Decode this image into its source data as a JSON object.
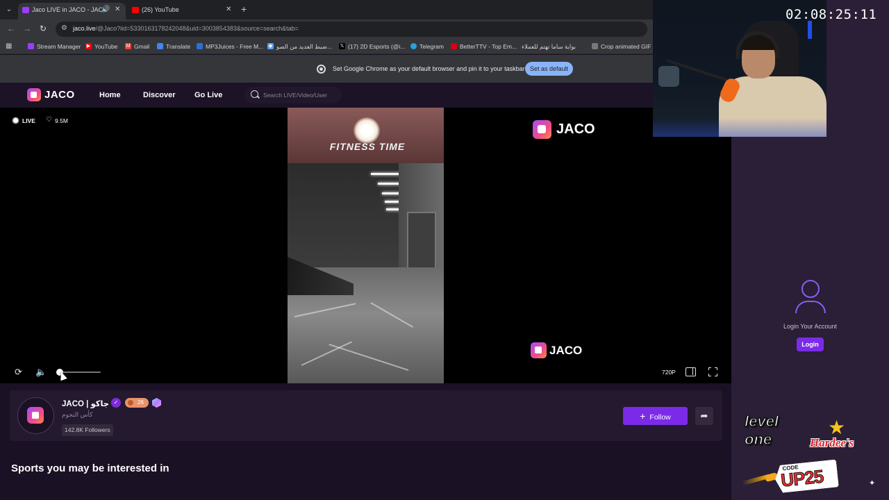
{
  "browser": {
    "tabs": [
      {
        "label": "Jaco LIVE in JACO - JACO",
        "active": true,
        "favicon_color": "#9b3dff"
      },
      {
        "label": "(26) YouTube",
        "active": false,
        "favicon_color": "#ff0000"
      }
    ],
    "tab_close_glyph": "✕",
    "new_tab_glyph": "+",
    "url_host": "jaco.live",
    "url_path": "/@Jaco?iid=5330163178242048&uid=3003854383&source=search&tab=",
    "bookmarks": [
      {
        "label": "Stream Manager",
        "icon_color": "#9b3dff"
      },
      {
        "label": "YouTube",
        "icon_color": "#ff0000"
      },
      {
        "label": "Gmail",
        "icon_color": "#ea4335"
      },
      {
        "label": "Translate",
        "icon_color": "#4285f4"
      },
      {
        "label": "MP3Juices - Free M...",
        "icon_color": "#2b6fd6"
      },
      {
        "label": "ضبط العديد من الصو...",
        "icon_color": "#5aa0ff"
      },
      {
        "label": "(17) 2D Esports (@i...",
        "icon_color": "#000000"
      },
      {
        "label": "Telegram",
        "icon_color": "#2aa1da"
      },
      {
        "label": "BetterTTV - Top Em...",
        "icon_color": "#d50014"
      },
      {
        "label": "بوابة ساما تهتم للعملاء",
        "icon_color": "#3a3a3a"
      },
      {
        "label": "Crop animated GIF",
        "icon_color": "#777777"
      }
    ],
    "infobar": {
      "message": "Set Google Chrome as your default browser and pin it to your taskbar",
      "button": "Set as default"
    }
  },
  "site": {
    "logo_text": "JACO",
    "nav": [
      "Home",
      "Discover",
      "Go Live"
    ],
    "search_placeholder": "Search LIVE/Video/User"
  },
  "player": {
    "live_label": "LIVE",
    "likes": "9.5M",
    "video_sign": "FITNESS TIME",
    "watermark": "JACO",
    "volume_fraction": 0.05,
    "quality": "720P"
  },
  "streamer": {
    "name": "JACO | جاكو",
    "level": "26",
    "subtitle": "كأس النجوم",
    "followers": "142.8K Followers",
    "follow_label": "Follow"
  },
  "section_title": "Sports you may be interested in",
  "sidebar": {
    "login_prompt": "Login Your Account",
    "login_button": "Login"
  },
  "overlay": {
    "timer": "02:08:25:11",
    "sponsor_level_one": "level one",
    "sponsor_hardees": "Hardee's",
    "code_label": "CODE",
    "code_value": "UP25"
  },
  "colors": {
    "accent": "#7b2be8",
    "page_bg": "#1b1124",
    "panel_bg": "#2a1f36"
  }
}
